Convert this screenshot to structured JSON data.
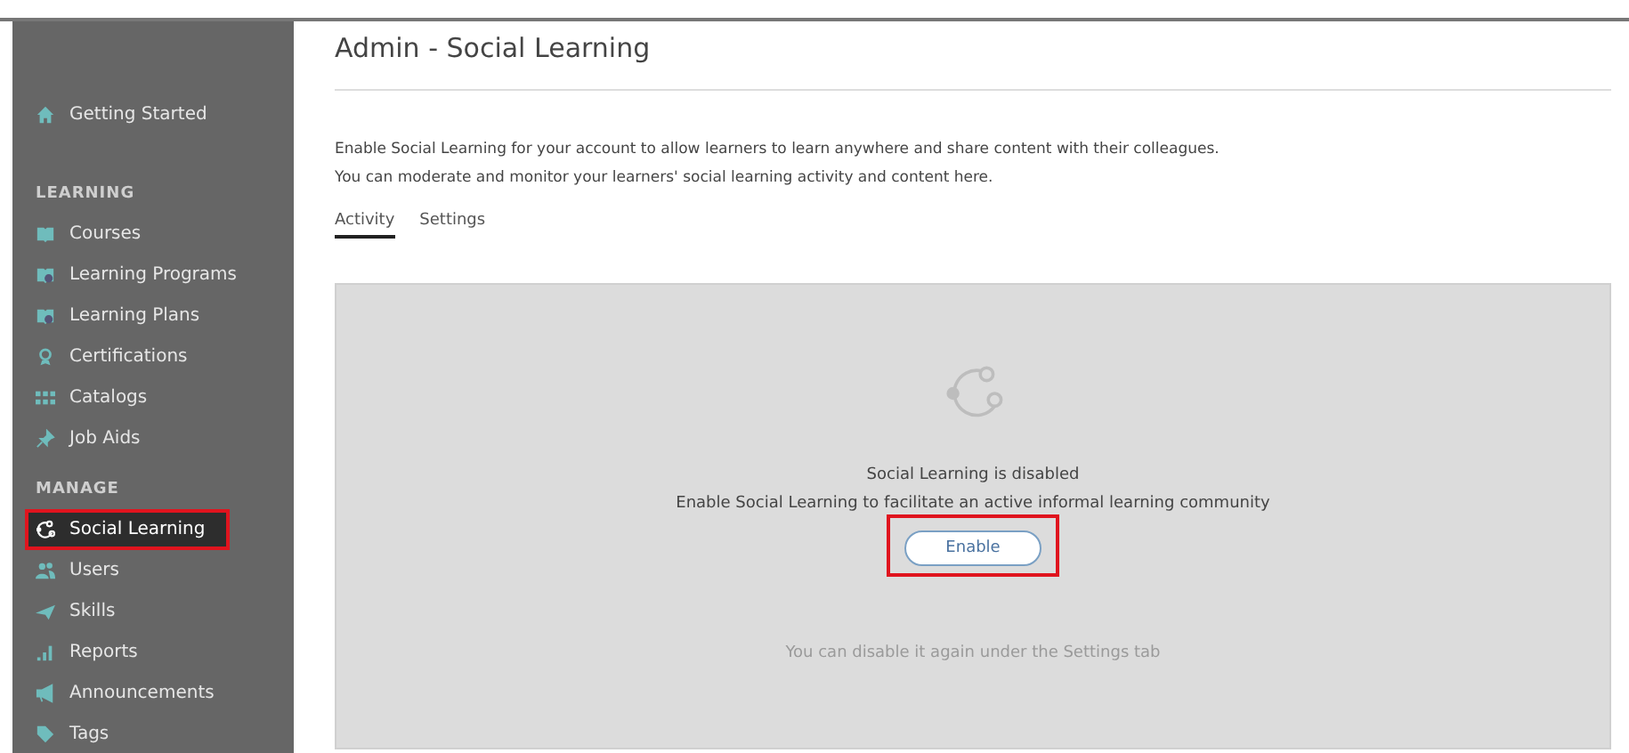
{
  "sidebar": {
    "top_item": {
      "label": "Getting Started",
      "selected": false,
      "highlighted": false
    },
    "sections": [
      {
        "heading": "LEARNING",
        "items": [
          {
            "label": "Courses",
            "selected": false,
            "highlighted": false
          },
          {
            "label": "Learning Programs",
            "selected": false,
            "highlighted": false
          },
          {
            "label": "Learning Plans",
            "selected": false,
            "highlighted": false
          },
          {
            "label": "Certifications",
            "selected": false,
            "highlighted": false
          },
          {
            "label": "Catalogs",
            "selected": false,
            "highlighted": false
          },
          {
            "label": "Job Aids",
            "selected": false,
            "highlighted": false
          }
        ]
      },
      {
        "heading": "MANAGE",
        "items": [
          {
            "label": "Social Learning",
            "selected": true,
            "highlighted": true
          },
          {
            "label": "Users",
            "selected": false,
            "highlighted": false
          },
          {
            "label": "Skills",
            "selected": false,
            "highlighted": false
          },
          {
            "label": "Reports",
            "selected": false,
            "highlighted": false
          },
          {
            "label": "Announcements",
            "selected": false,
            "highlighted": false
          },
          {
            "label": "Tags",
            "selected": false,
            "highlighted": false
          }
        ]
      }
    ]
  },
  "page": {
    "title": "Admin - Social Learning",
    "description": [
      "Enable Social Learning for your account to allow learners to learn anywhere and share content with their colleagues.",
      "You can moderate and monitor your learners' social learning activity and content here."
    ],
    "tabs": [
      {
        "label": "Activity",
        "selected": true
      },
      {
        "label": "Settings",
        "selected": false
      }
    ],
    "panel": {
      "status": "Social Learning is disabled",
      "message": "Enable Social Learning to facilitate an active informal learning community",
      "button": {
        "label": "Enable",
        "highlighted": true
      },
      "note": "You can disable it again under the Settings tab"
    }
  }
}
